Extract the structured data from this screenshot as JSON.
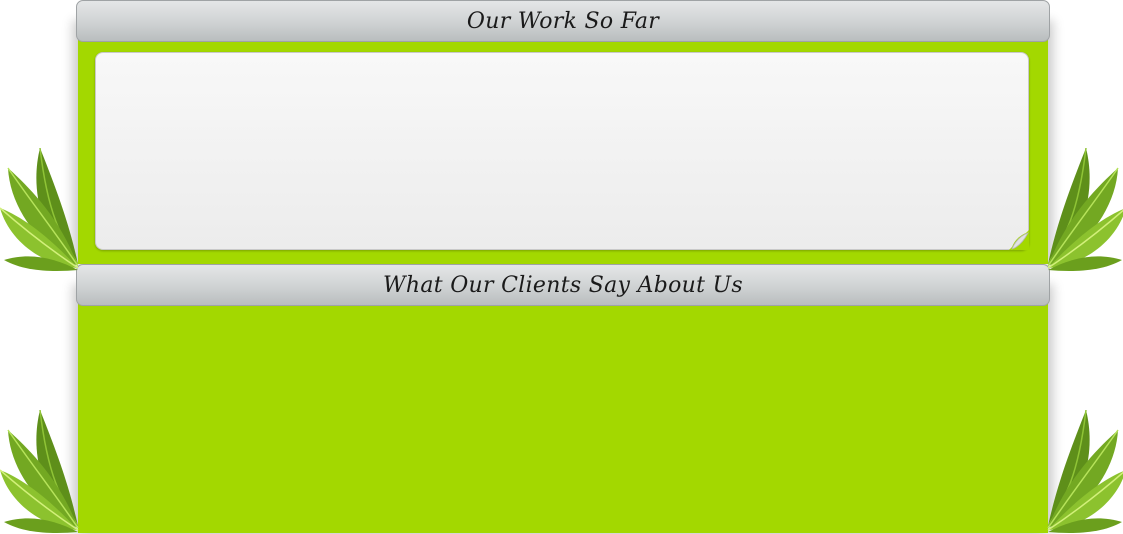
{
  "sections": [
    {
      "title": "Our Work So Far"
    },
    {
      "title": "What Our Clients Say About Us"
    }
  ],
  "colors": {
    "section_background": "#a3d800",
    "header_gradient_top": "#e4e6e7",
    "header_gradient_bottom": "#b9bdbe",
    "panel_background": "#f2f2f2",
    "leaf_dark": "#5e8f1a",
    "leaf_light": "#9ccf2f"
  },
  "icons": [
    "leaf-cluster-icon",
    "page-curl-icon"
  ]
}
